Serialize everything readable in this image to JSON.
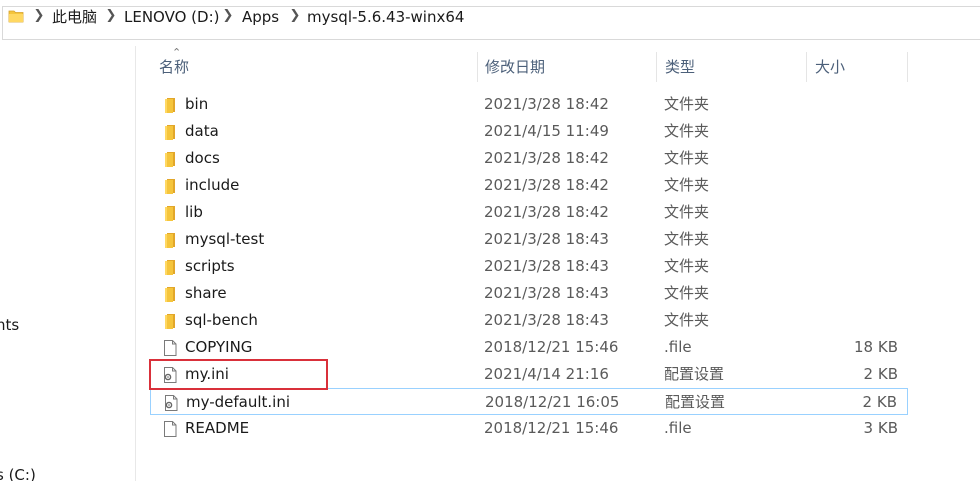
{
  "breadcrumb": {
    "items": [
      "此电脑",
      "LENOVO (D:)",
      "Apps",
      "mysql-5.6.43-winx64"
    ]
  },
  "navpane": {
    "partial_items": [
      "nts",
      "s (C:)"
    ]
  },
  "columns": {
    "name": "名称",
    "date": "修改日期",
    "type": "类型",
    "size": "大小"
  },
  "files": [
    {
      "name": "bin",
      "date": "2021/3/28 18:42",
      "type": "文件夹",
      "size": "",
      "icon": "folder-icon"
    },
    {
      "name": "data",
      "date": "2021/4/15 11:49",
      "type": "文件夹",
      "size": "",
      "icon": "folder-icon"
    },
    {
      "name": "docs",
      "date": "2021/3/28 18:42",
      "type": "文件夹",
      "size": "",
      "icon": "folder-icon"
    },
    {
      "name": "include",
      "date": "2021/3/28 18:42",
      "type": "文件夹",
      "size": "",
      "icon": "folder-icon"
    },
    {
      "name": "lib",
      "date": "2021/3/28 18:42",
      "type": "文件夹",
      "size": "",
      "icon": "folder-icon"
    },
    {
      "name": "mysql-test",
      "date": "2021/3/28 18:43",
      "type": "文件夹",
      "size": "",
      "icon": "folder-icon"
    },
    {
      "name": "scripts",
      "date": "2021/3/28 18:43",
      "type": "文件夹",
      "size": "",
      "icon": "folder-icon"
    },
    {
      "name": "share",
      "date": "2021/3/28 18:43",
      "type": "文件夹",
      "size": "",
      "icon": "folder-icon"
    },
    {
      "name": "sql-bench",
      "date": "2021/3/28 18:43",
      "type": "文件夹",
      "size": "",
      "icon": "folder-icon"
    },
    {
      "name": "COPYING",
      "date": "2018/12/21 15:46",
      "type": ".file",
      "size": "18 KB",
      "icon": "file-icon"
    },
    {
      "name": "my.ini",
      "date": "2021/4/14 21:16",
      "type": "配置设置",
      "size": "2 KB",
      "icon": "settings-file-icon"
    },
    {
      "name": "my-default.ini",
      "date": "2018/12/21 16:05",
      "type": "配置设置",
      "size": "2 KB",
      "icon": "settings-file-icon"
    },
    {
      "name": "README",
      "date": "2018/12/21 15:46",
      "type": ".file",
      "size": "3 KB",
      "icon": "file-icon"
    }
  ],
  "colors": {
    "folder": "#f5c53c",
    "folder_dark": "#e2a72a",
    "selection_border": "#99d1ff",
    "highlight_box": "#d9303a",
    "header_text": "#4c607a"
  }
}
